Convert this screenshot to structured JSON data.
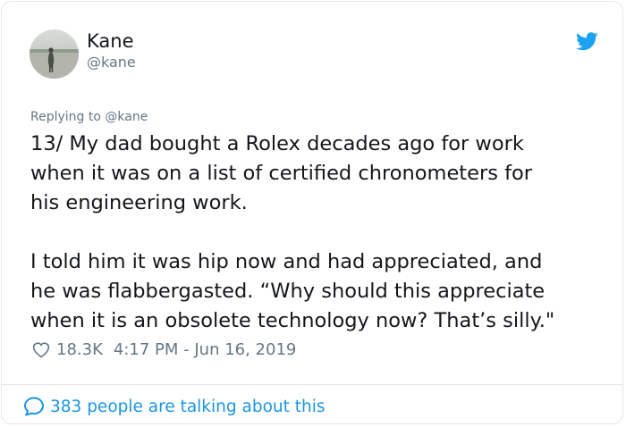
{
  "author": {
    "display_name": "Kane",
    "handle": "@kane",
    "avatar_icon": "profile-photo"
  },
  "brand": {
    "icon": "twitter-bird-icon",
    "color": "#1da1f2"
  },
  "tweet": {
    "reply_context": "Replying to @kane",
    "paragraphs": [
      "13/ My dad bought a Rolex decades ago for work\nwhen it was on a list of certified chronometers for\nhis engineering work.",
      "I told him it was hip now and had appreciated, and\nhe was flabbergasted. “Why should this appreciate\nwhen it is an obsolete technology now? That’s silly.\""
    ],
    "likes": "18.3K",
    "timestamp": "4:17 PM - Jun 16, 2019"
  },
  "footer": {
    "conversation_text": "383 people are talking about this",
    "icon": "speech-bubble-icon",
    "link_color": "#1b95e0"
  }
}
